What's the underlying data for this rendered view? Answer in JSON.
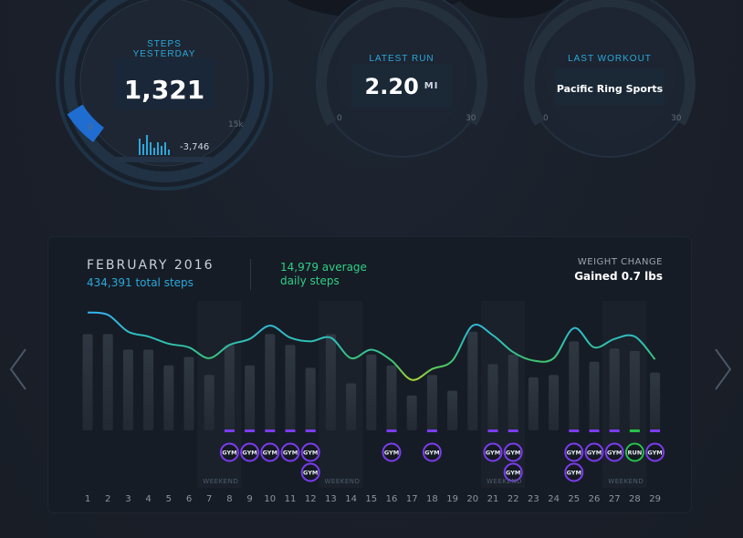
{
  "gauges": [
    {
      "label_line1": "STEPS",
      "label_line2": "YESTERDAY",
      "value": "1,321",
      "min_tick": "0",
      "max_tick": "15k",
      "delta": "-3,746"
    },
    {
      "label_line1": "LATEST RUN",
      "value": "2.20",
      "unit": "MI",
      "min_tick": "0",
      "max_tick": "30"
    },
    {
      "label_line1": "LAST WORKOUT",
      "value": "Pacific Ring Sports",
      "min_tick": "0",
      "max_tick": "30"
    }
  ],
  "summary": {
    "month": "FEBRUARY 2016",
    "total_steps": "434,391 total steps",
    "average_line1": "14,979 average",
    "average_line2": "daily steps",
    "weight_change_label": "WEIGHT CHANGE",
    "weight_change_value": "Gained 0.7 lbs"
  },
  "colors": {
    "accent_blue": "#2ba8dc",
    "accent_green": "#2fcf87",
    "gym_purple": "#7b3cf0",
    "run_green": "#27c24a"
  },
  "weekend_label": "WEEKEND",
  "chart_data": {
    "type": "bar",
    "days": [
      "1",
      "2",
      "3",
      "4",
      "5",
      "6",
      "7",
      "8",
      "9",
      "10",
      "11",
      "12",
      "13",
      "14",
      "15",
      "16",
      "17",
      "18",
      "19",
      "20",
      "21",
      "22",
      "23",
      "24",
      "25",
      "26",
      "27",
      "28",
      "29"
    ],
    "bar_fraction": [
      0.8,
      0.8,
      0.67,
      0.67,
      0.54,
      0.61,
      0.46,
      0.71,
      0.54,
      0.8,
      0.71,
      0.52,
      0.8,
      0.39,
      0.63,
      0.54,
      0.29,
      0.46,
      0.33,
      0.82,
      0.55,
      0.63,
      0.44,
      0.46,
      0.74,
      0.57,
      0.68,
      0.66,
      0.48
    ],
    "line_fraction": [
      0.98,
      0.96,
      0.82,
      0.78,
      0.72,
      0.69,
      0.6,
      0.71,
      0.76,
      0.87,
      0.77,
      0.74,
      0.77,
      0.6,
      0.67,
      0.58,
      0.42,
      0.51,
      0.58,
      0.87,
      0.79,
      0.65,
      0.58,
      0.6,
      0.85,
      0.69,
      0.76,
      0.78,
      0.59
    ],
    "weekend_days": [
      7,
      13,
      21,
      27
    ],
    "activities": [
      {
        "day": 8,
        "items": [
          "GYM"
        ]
      },
      {
        "day": 9,
        "items": [
          "GYM"
        ]
      },
      {
        "day": 10,
        "items": [
          "GYM"
        ]
      },
      {
        "day": 11,
        "items": [
          "GYM"
        ]
      },
      {
        "day": 12,
        "items": [
          "GYM",
          "GYM"
        ]
      },
      {
        "day": 16,
        "items": [
          "GYM"
        ]
      },
      {
        "day": 18,
        "items": [
          "GYM"
        ]
      },
      {
        "day": 21,
        "items": [
          "GYM"
        ]
      },
      {
        "day": 22,
        "items": [
          "GYM",
          "GYM"
        ]
      },
      {
        "day": 25,
        "items": [
          "GYM",
          "GYM"
        ]
      },
      {
        "day": 26,
        "items": [
          "GYM"
        ]
      },
      {
        "day": 27,
        "items": [
          "GYM"
        ]
      },
      {
        "day": 28,
        "items": [
          "RUN"
        ]
      },
      {
        "day": 29,
        "items": [
          "GYM"
        ]
      }
    ]
  }
}
